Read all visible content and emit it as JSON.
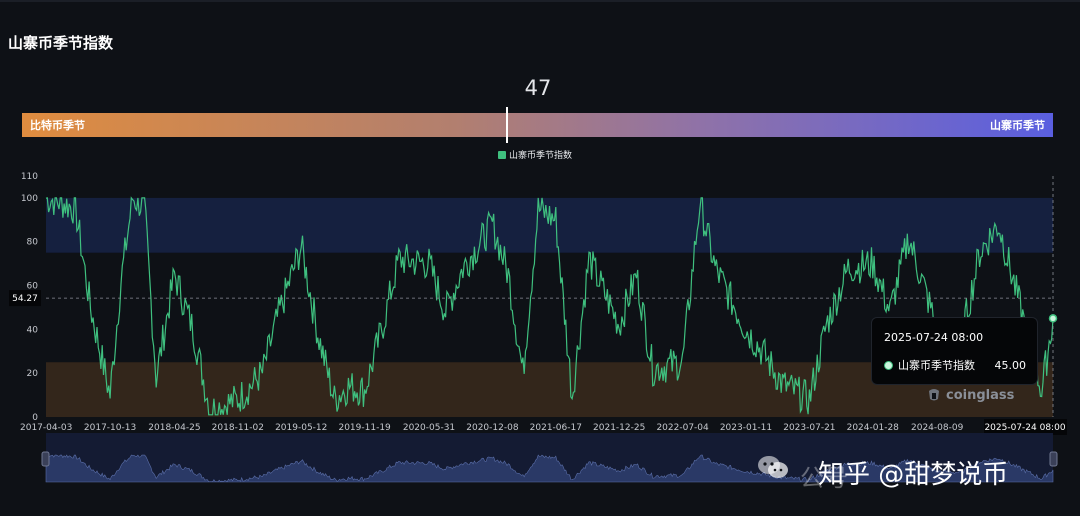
{
  "title": "山寨币季节指数",
  "index_value": "47",
  "gauge": {
    "left_label": "比特币季节",
    "right_label": "山寨币季节",
    "value": 47,
    "min": 0,
    "max": 100
  },
  "legend_label": "山寨币季节指数",
  "crosshair": {
    "y_label": "54.27",
    "x_label": "2025-07-24 08:00"
  },
  "tooltip": {
    "date": "2025-07-24 08:00",
    "series_name": "山寨币季节指数",
    "value": "45.00"
  },
  "branding": {
    "coinglass": "coinglass",
    "watermark": "知乎 @甜梦说币",
    "watermark_faded": "公号"
  },
  "colors": {
    "line": "#3fc07f",
    "altcoin_zone": "#15203f",
    "bitcoin_zone": "#33261b",
    "background": "#0e1116"
  },
  "chart_data": {
    "type": "line",
    "title": "山寨币季节指数",
    "series": [
      {
        "name": "山寨币季节指数",
        "x": [
          "2017-04-03",
          "2017-05-20",
          "2017-07-01",
          "2017-08-15",
          "2017-10-13",
          "2017-11-15",
          "2017-12-20",
          "2018-01-25",
          "2018-03-01",
          "2018-04-25",
          "2018-06-20",
          "2018-08-10",
          "2018-11-02",
          "2019-01-15",
          "2019-03-01",
          "2019-05-12",
          "2019-07-01",
          "2019-08-20",
          "2019-10-01",
          "2019-11-19",
          "2020-01-10",
          "2020-03-01",
          "2020-05-31",
          "2020-07-20",
          "2020-09-10",
          "2020-12-08",
          "2021-01-25",
          "2021-03-10",
          "2021-04-25",
          "2021-06-17",
          "2021-08-05",
          "2021-09-25",
          "2021-12-25",
          "2022-02-15",
          "2022-04-05",
          "2022-07-04",
          "2022-08-25",
          "2022-10-10",
          "2023-01-11",
          "2023-03-01",
          "2023-05-01",
          "2023-07-21",
          "2023-09-10",
          "2023-11-15",
          "2024-01-28",
          "2024-03-20",
          "2024-05-15",
          "2024-08-09",
          "2024-10-20",
          "2024-12-15",
          "2025-02-10",
          "2025-04-20",
          "2025-06-20",
          "2025-07-24"
        ],
        "y": [
          100,
          98,
          95,
          50,
          10,
          62,
          100,
          96,
          18,
          65,
          40,
          3,
          8,
          20,
          45,
          78,
          38,
          8,
          14,
          12,
          40,
          72,
          70,
          48,
          68,
          88,
          65,
          20,
          95,
          90,
          10,
          72,
          42,
          65,
          22,
          25,
          98,
          68,
          40,
          30,
          15,
          8,
          42,
          68,
          70,
          48,
          82,
          40,
          35,
          75,
          88,
          48,
          12,
          45
        ]
      }
    ],
    "ylim": [
      0,
      110
    ],
    "y_ticks": [
      0,
      20,
      40,
      60,
      80,
      100,
      110
    ],
    "x_ticks": [
      "2017-04-03",
      "2017-10-13",
      "2018-04-25",
      "2018-11-02",
      "2019-05-12",
      "2019-11-19",
      "2020-05-31",
      "2020-12-08",
      "2021-06-17",
      "2021-12-25",
      "2022-07-04",
      "2023-01-11",
      "2023-07-21",
      "2024-01-28",
      "2024-08-09",
      "2025-07-24"
    ],
    "bands": [
      {
        "from": 75,
        "to": 100,
        "color": "#15203f"
      },
      {
        "from": 0,
        "to": 25,
        "color": "#33261b"
      }
    ],
    "grid": false,
    "legend": "top-center"
  }
}
